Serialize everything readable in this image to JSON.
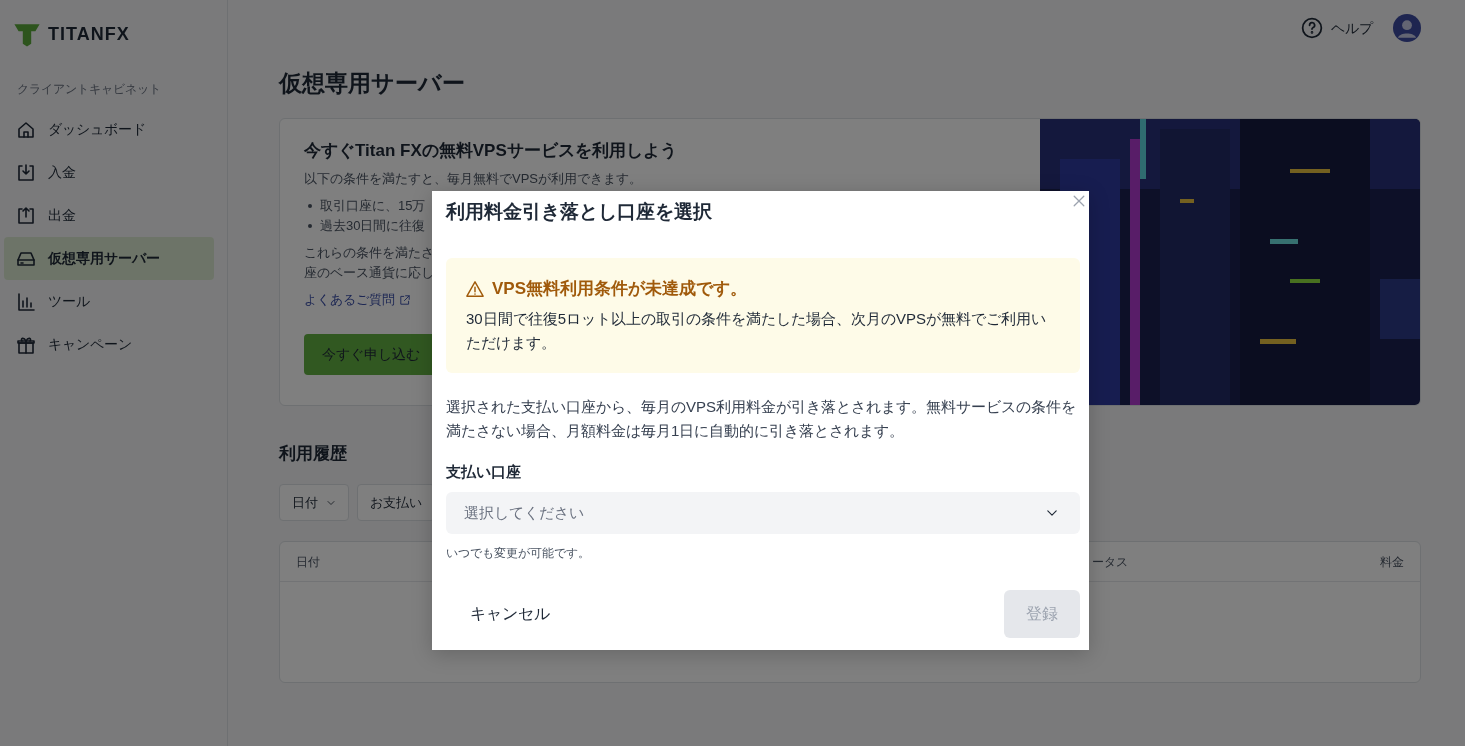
{
  "sidebar": {
    "logo": "TITANFX",
    "section_label": "クライアントキャビネット",
    "items": [
      {
        "label": "ダッシュボード",
        "selected": false
      },
      {
        "label": "入金",
        "selected": false
      },
      {
        "label": "出金",
        "selected": false
      },
      {
        "label": "仮想専用サーバー",
        "selected": true
      },
      {
        "label": "ツール",
        "selected": false
      },
      {
        "label": "キャンペーン",
        "selected": false
      }
    ]
  },
  "header": {
    "help": "ヘルプ"
  },
  "page_title": "仮想専用サーバー",
  "promo": {
    "heading": "今すぐTitan FXの無料VPSサービスを利用しよう",
    "intro": "以下の条件を満たすと、毎月無料でVPSが利用できます。",
    "bullets": [
      "取引口座に、15万",
      "過去30日間に往復"
    ],
    "lines": [
      "これらの条件を満たさ",
      "座のベース通貨に応し"
    ],
    "link": "よくあるご質問",
    "button": "今すぐ申し込む",
    "image": {
      "kind": "picture"
    }
  },
  "history": {
    "title": "利用履歴",
    "filters": [
      {
        "label": "日付",
        "kind": "dropdown"
      },
      {
        "label": "お支払い",
        "kind": "partial"
      }
    ],
    "columns": [
      "日付",
      "ータス",
      "料金"
    ]
  },
  "modal": {
    "title": "利用料金引き落とし口座を選択",
    "alert": {
      "title": "VPS無料利用条件が未達成です。",
      "body": "30日間で往復5ロット以上の取引の条件を満たした場合、次月のVPSが無料でご利用いただけます。"
    },
    "description": "選択された支払い口座から、毎月のVPS利用料金が引き落とされます。無料サービスの条件を満たさない場合、月額料金は毎月1日に自動的に引き落とされます。",
    "field_label": "支払い口座",
    "placeholder": "選択してください",
    "hint": "いつでも変更が可能です。",
    "cancel": "キャンセル",
    "submit": {
      "label": "登録",
      "disabled": true
    }
  }
}
